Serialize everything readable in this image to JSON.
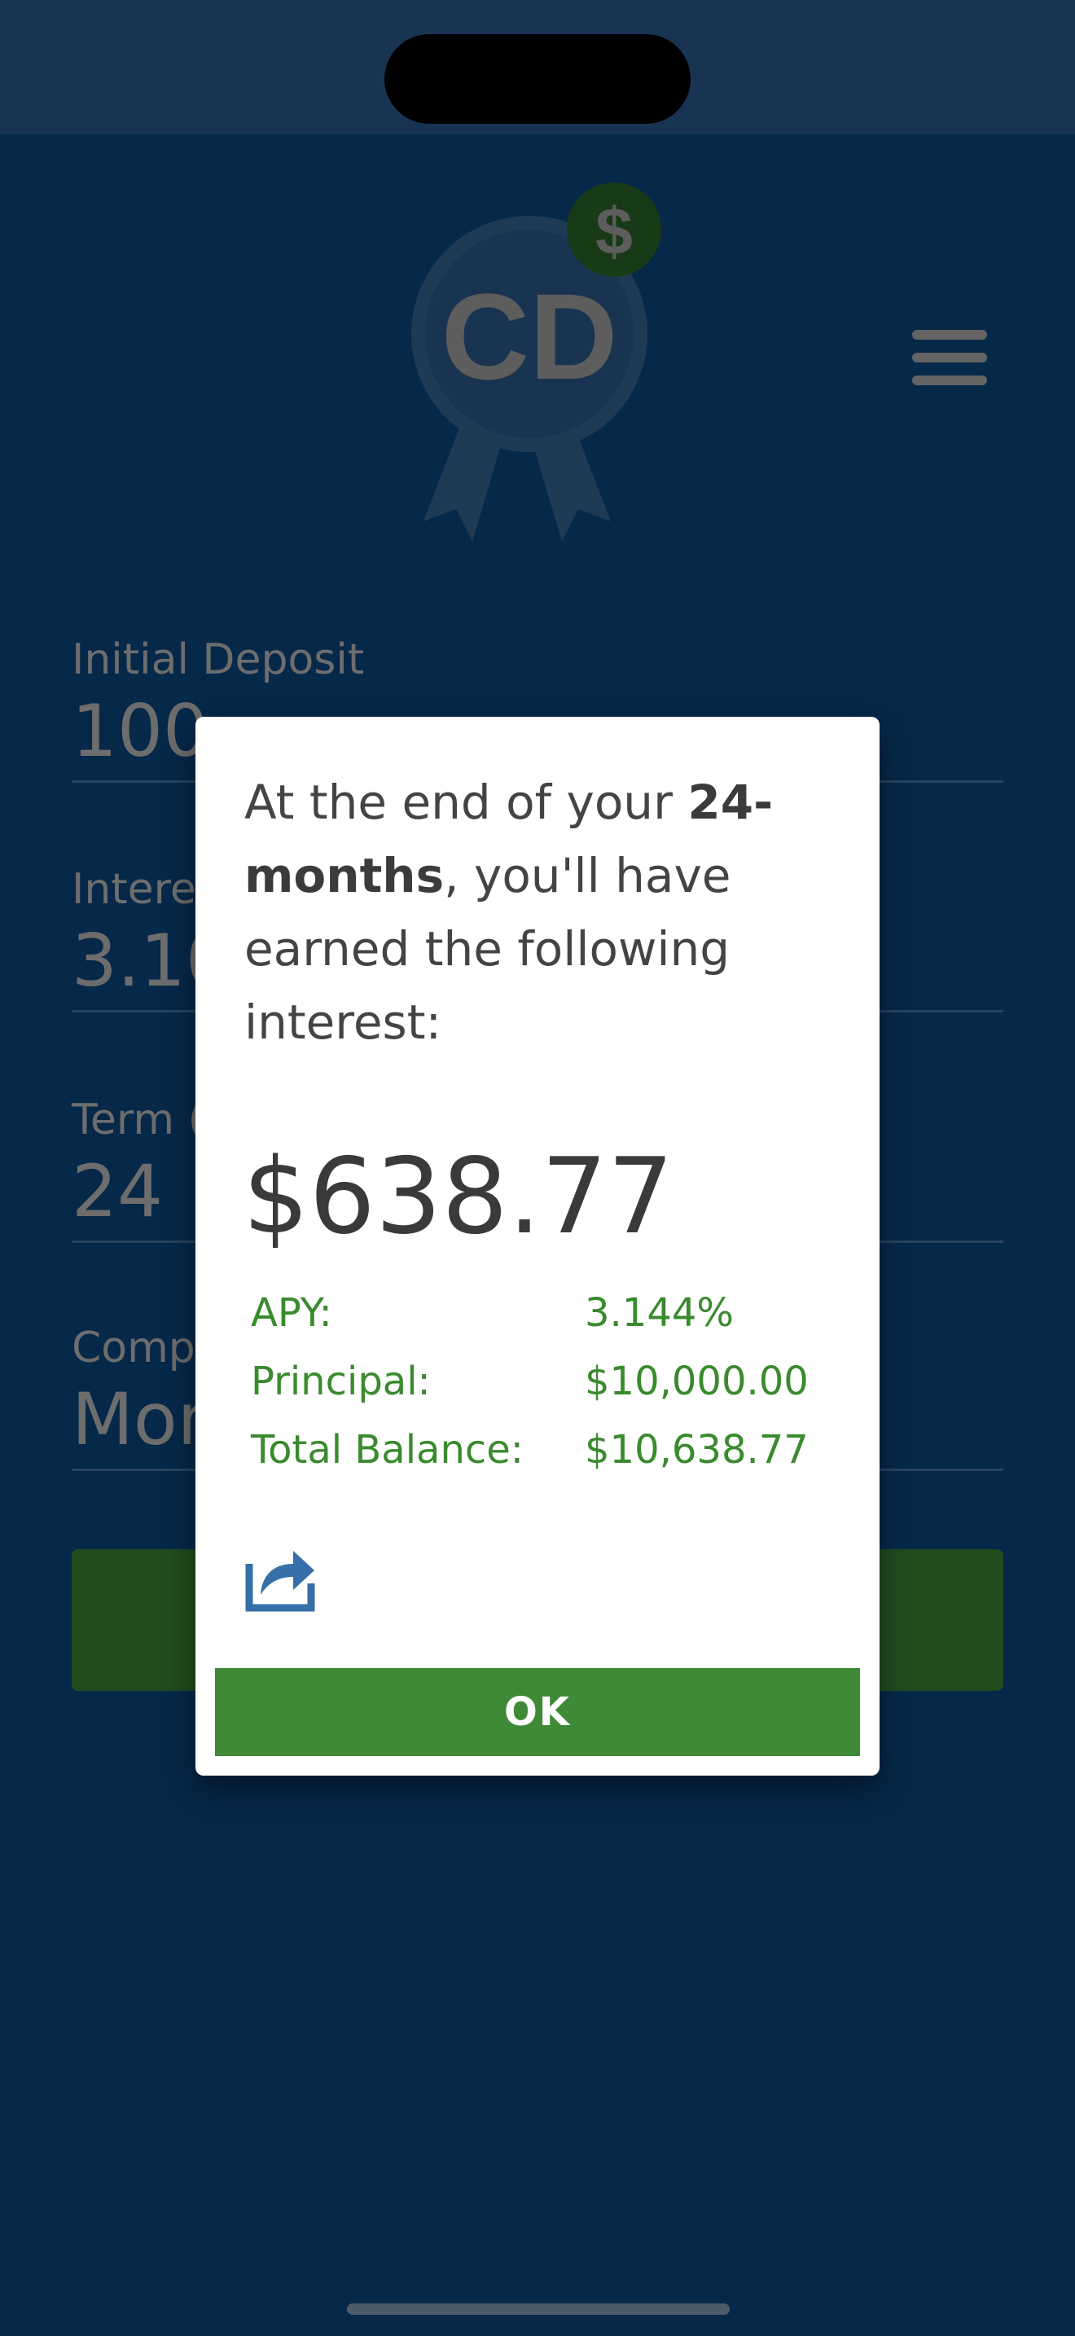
{
  "logo": {
    "text": "CD",
    "badge": "$"
  },
  "form": {
    "initial_deposit": {
      "label": "Initial Deposit",
      "value": "100"
    },
    "interest": {
      "label": "Interes",
      "value": "3.10"
    },
    "term": {
      "label": "Term (",
      "value": "24"
    },
    "compounding": {
      "label": "Comp",
      "value": "Mon"
    }
  },
  "dialog": {
    "message_part1": "At the end of your ",
    "message_bold": "24-months",
    "message_part2": ", you'll have earned the following interest:",
    "amount": "$638.77",
    "details": [
      {
        "label": "APY:",
        "value": "3.144%"
      },
      {
        "label": "Principal:",
        "value": "$10,000.00"
      },
      {
        "label": "Total Balance:",
        "value": "$10,638.77"
      }
    ],
    "share_icon": "share-icon",
    "ok_label": "OK"
  },
  "colors": {
    "background": "#0b4a86",
    "accent_green": "#3f8a37",
    "share_blue": "#3570a8"
  }
}
